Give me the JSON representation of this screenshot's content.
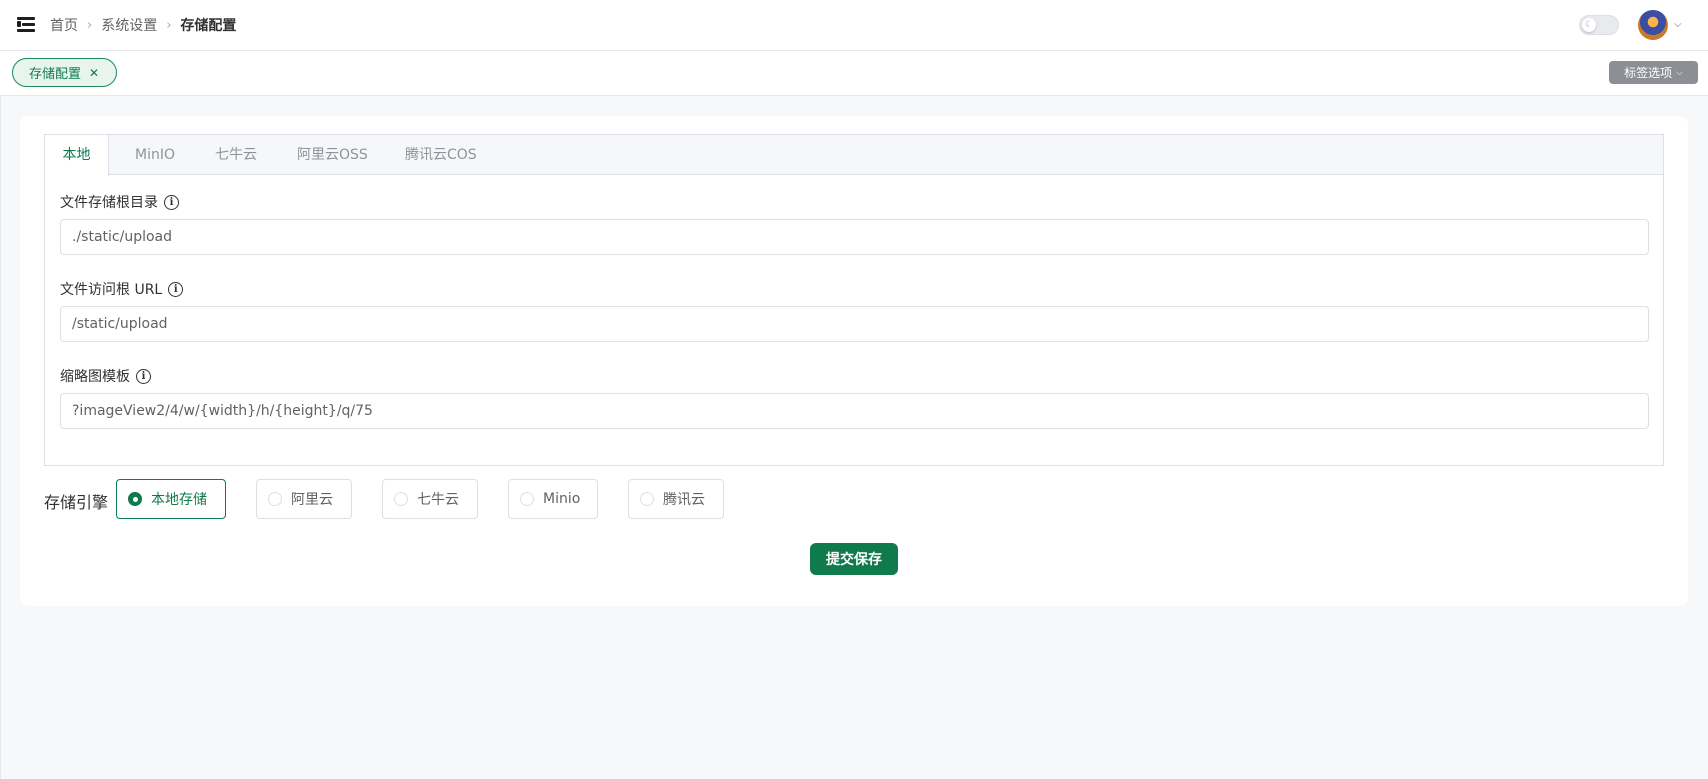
{
  "header": {
    "breadcrumb": [
      "首页",
      "系统设置",
      "存储配置"
    ]
  },
  "tagsbar": {
    "active_tag": "存储配置",
    "close_glyph": "✕",
    "options_label": "标签选项"
  },
  "tabs": [
    {
      "label": "本地",
      "active": true
    },
    {
      "label": "MinIO",
      "active": false
    },
    {
      "label": "七牛云",
      "active": false
    },
    {
      "label": "阿里云OSS",
      "active": false
    },
    {
      "label": "腾讯云COS",
      "active": false
    }
  ],
  "form": {
    "fields": [
      {
        "label": "文件存储根目录",
        "value": "./static/upload"
      },
      {
        "label": "文件访问根 URL",
        "value": "/static/upload"
      },
      {
        "label": "缩略图模板",
        "value": "?imageView2/4/w/{width}/h/{height}/q/75"
      }
    ]
  },
  "engine": {
    "label": "存储引擎",
    "options": [
      {
        "label": "本地存储",
        "checked": true
      },
      {
        "label": "阿里云",
        "checked": false
      },
      {
        "label": "七牛云",
        "checked": false
      },
      {
        "label": "Minio",
        "checked": false
      },
      {
        "label": "腾讯云",
        "checked": false
      }
    ]
  },
  "submit_label": "提交保存",
  "colors": {
    "primary": "#0f7a4c",
    "tag_bg": "#e8f5ee",
    "page_bg": "#f7f8fa"
  },
  "icons": {
    "menu": "hamburger-icon",
    "separator": "chevron-right-icon",
    "theme": "moon-icon",
    "info": "info-circle-icon",
    "dropdown": "chevron-down-icon"
  }
}
